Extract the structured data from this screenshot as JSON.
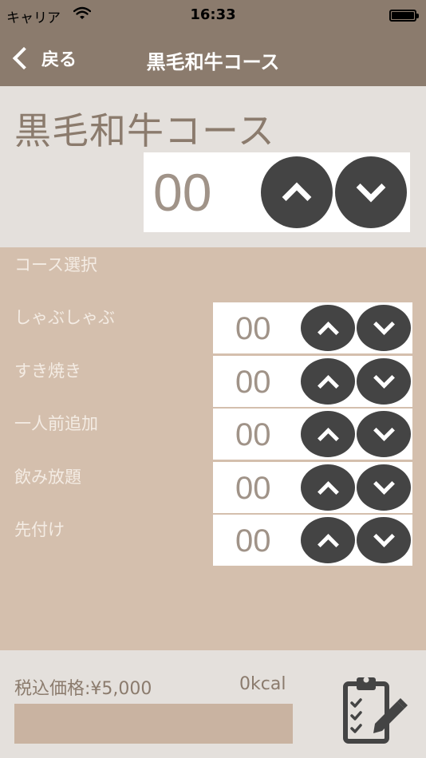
{
  "status_bar": {
    "carrier": "キャリア",
    "time": "16:33"
  },
  "navbar": {
    "back_label": "戻る",
    "title": "黒毛和牛コース"
  },
  "course": {
    "title": "黒毛和牛コース",
    "count": "00"
  },
  "section": {
    "label": "コース選択"
  },
  "rows": [
    {
      "label": " しゃぶしゃぶ",
      "count": "00"
    },
    {
      "label": " すき焼き",
      "count": "00"
    },
    {
      "label": "一人前追加",
      "count": "00"
    },
    {
      "label": "飲み放題",
      "count": "00"
    },
    {
      "label": "先付け",
      "count": "00"
    }
  ],
  "footer": {
    "price": "税込価格:¥5,000",
    "kcal": "0kcal",
    "progress": 0
  },
  "icons": {
    "back": "chevron-left-icon",
    "up": "chevron-up-icon",
    "down": "chevron-down-icon",
    "order": "clipboard-edit-icon"
  },
  "colors": {
    "brand": "#8b7b6d",
    "panel": "#d4bfad",
    "light": "#e4e0dc",
    "button": "#444444"
  }
}
